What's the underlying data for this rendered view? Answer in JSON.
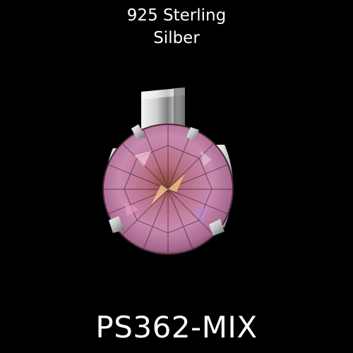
{
  "caption": {
    "line1": "925 Sterling",
    "line2": "Silber"
  },
  "product_code": "PS362-MIX",
  "colors": {
    "background": "#000000",
    "text": "#ffffff",
    "gem_primary": "#c98ab0",
    "gem_dark": "#6a3a4e",
    "gem_highlight": "#f0c07a",
    "silver": "#d8d8d8"
  },
  "photo": {
    "subject": "pendant-with-round-pink-gemstone"
  }
}
